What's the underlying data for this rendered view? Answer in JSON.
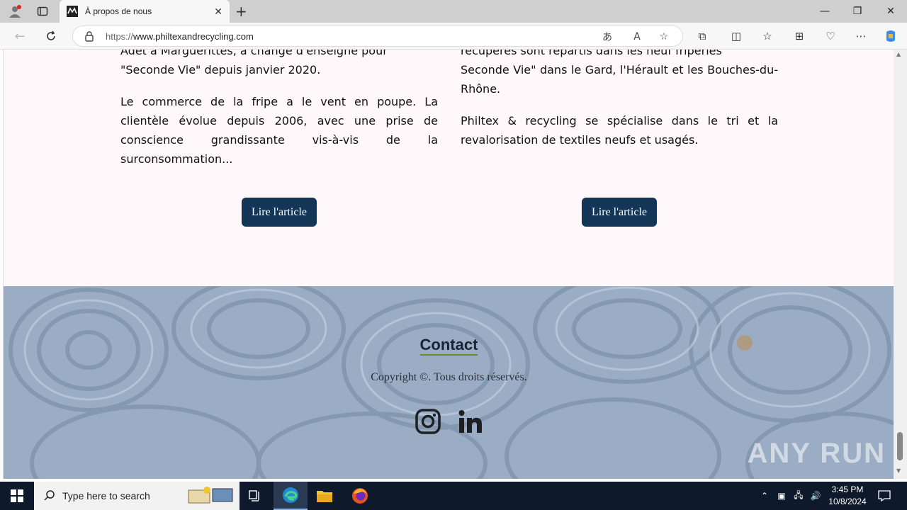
{
  "browser": {
    "tab_title": "À propos de nous",
    "url_prefix": "https://",
    "url_host": "www.philtexandrecycling.com",
    "new_tab_label": "+"
  },
  "article_left": {
    "line_cut": "Adet à Marguerittes, a changé d'enseigne pour",
    "p1": "\"Seconde Vie\" depuis janvier 2020.",
    "p2": "Le commerce de la fripe a le vent en poupe. La clientèle évolue depuis 2006, avec une prise de conscience grandissante vis-à-vis de la surconsommation...",
    "button": "Lire l'article"
  },
  "article_right": {
    "line_cut": "récupérés sont répartis dans les neuf friperies",
    "p1": "Seconde Vie\" dans le Gard, l'Hérault et les Bouches-du-Rhône.",
    "p2": "Philtex & recycling se spécialise dans le tri et la revalorisation de textiles neufs et usagés.",
    "button": "Lire l'article"
  },
  "footer": {
    "contact": "Contact",
    "copyright": "Copyright ©. Tous droits réservés.",
    "watermark": "ANY RUN"
  },
  "taskbar": {
    "search_placeholder": "Type here to search",
    "time": "3:45 PM",
    "date": "10/8/2024"
  },
  "colors": {
    "button_bg": "#133556",
    "page_bg": "#fff8fa",
    "taskbar_bg": "#0e1a2b"
  }
}
